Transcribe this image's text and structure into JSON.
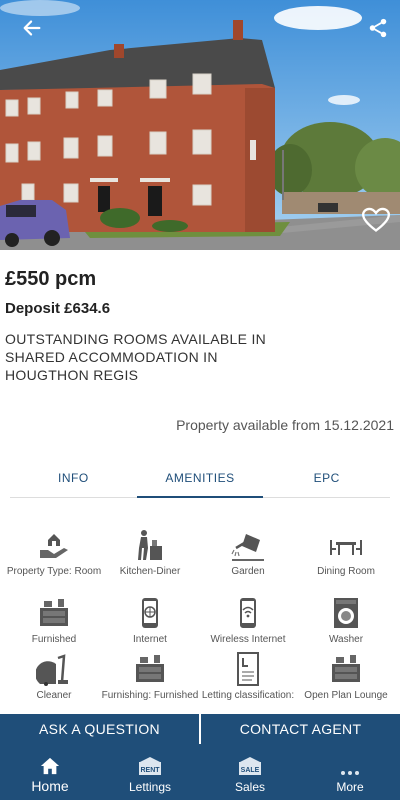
{
  "listing": {
    "price": "£550 pcm",
    "deposit": "Deposit £634.6",
    "headline": "OUTSTANDING ROOMS AVAILABLE IN SHARED ACCOMMODATION IN HOUGTHON REGIS",
    "available": "Property available from 15.12.2021"
  },
  "hero": {
    "back_icon": "arrow-left-icon",
    "share_icon": "share-icon",
    "favourite_icon": "heart-outline-icon"
  },
  "tabs": [
    {
      "label": "INFO",
      "active": false
    },
    {
      "label": "AMENITIES",
      "active": true
    },
    {
      "label": "EPC",
      "active": false
    }
  ],
  "amenities": [
    {
      "label": "Property Type: Room",
      "icon": "house-hand-icon"
    },
    {
      "label": "Kitchen-Diner",
      "icon": "person-cooking-icon"
    },
    {
      "label": "Garden",
      "icon": "watering-can-icon"
    },
    {
      "label": "Dining Room",
      "icon": "dining-table-icon"
    },
    {
      "label": "Furnished",
      "icon": "furniture-icon"
    },
    {
      "label": "Internet",
      "icon": "globe-phone-icon"
    },
    {
      "label": "Wireless Internet",
      "icon": "wifi-phone-icon"
    },
    {
      "label": "Washer",
      "icon": "washing-machine-icon"
    },
    {
      "label": "Cleaner",
      "icon": "vacuum-cleaner-icon"
    },
    {
      "label": "Furnishing: Furnished",
      "icon": "furniture-icon"
    },
    {
      "label": "Letting classification:",
      "icon": "document-icon"
    },
    {
      "label": "Open Plan Lounge",
      "icon": "furniture-icon"
    }
  ],
  "actions": {
    "ask": "ASK A QUESTION",
    "contact": "CONTACT AGENT"
  },
  "nav": [
    {
      "label": "Home",
      "icon": "home-icon",
      "active": true
    },
    {
      "label": "Lettings",
      "icon": "rent-sign-icon",
      "badge": "RENT",
      "active": false
    },
    {
      "label": "Sales",
      "icon": "sale-sign-icon",
      "badge": "SALE",
      "active": false
    },
    {
      "label": "More",
      "icon": "more-dots-icon",
      "active": false
    }
  ],
  "colors": {
    "brand": "#1f4e79",
    "text": "#333333"
  }
}
